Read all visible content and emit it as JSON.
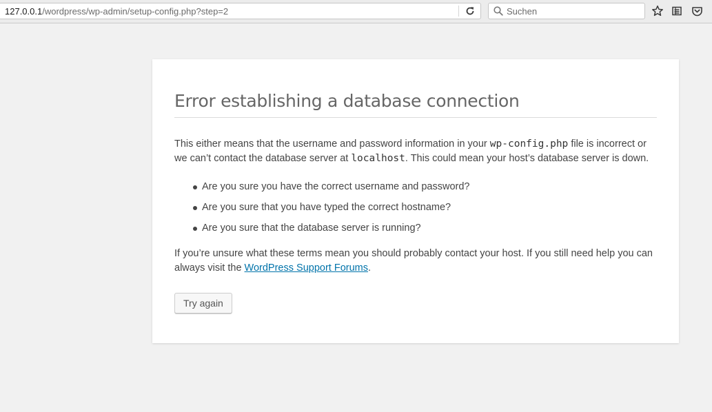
{
  "browser": {
    "url_host": "127.0.0.1",
    "url_path": "/wordpress/wp-admin/setup-config.php?step=2",
    "search_placeholder": "Suchen",
    "icons": {
      "reload": "reload-icon",
      "search": "search-icon",
      "bookmark": "star-icon",
      "reading_list": "reading-list-icon",
      "pocket": "pocket-icon"
    }
  },
  "error": {
    "title": "Error establishing a database connection",
    "p1_part1": "This either means that the username and password information in your ",
    "p1_code1": "wp-config.php",
    "p1_part2": " file is incorrect or we can’t contact the database server at ",
    "p1_code2": "localhost",
    "p1_part3": ". This could mean your host’s database server is down.",
    "checks": [
      "Are you sure you have the correct username and password?",
      "Are you sure that you have typed the correct hostname?",
      "Are you sure that the database server is running?"
    ],
    "p2_part1": "If you’re unsure what these terms mean you should probably contact your host. If you still need help you can always visit the ",
    "p2_link": "WordPress Support Forums",
    "p2_part2": ".",
    "button_label": "Try again"
  },
  "colors": {
    "page_bg": "#f1f1f1",
    "card_bg": "#ffffff",
    "link": "#0073aa",
    "text": "#444444",
    "heading": "#666666"
  }
}
